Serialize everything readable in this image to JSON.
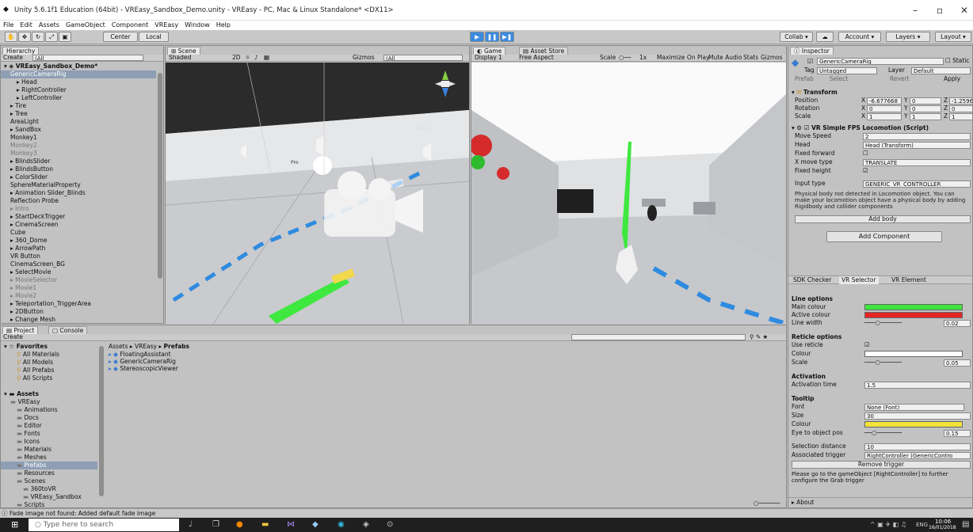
{
  "window": {
    "title": "Unity 5.6.1f1 Education (64bit) - VREasy_Sandbox_Demo.unity - VREasy - PC, Mac & Linux Standalone* <DX11>"
  },
  "menu": [
    "File",
    "Edit",
    "Assets",
    "GameObject",
    "Component",
    "VREasy",
    "Window",
    "Help"
  ],
  "toolbar": {
    "center": "Center",
    "local": "Local",
    "collab": "Collab",
    "account": "Account",
    "layers": "Layers",
    "layout": "Layout"
  },
  "hierarchy": {
    "tab": "Hierarchy",
    "create": "Create",
    "search": "(All",
    "scene": "VREasy_Sandbox_Demo*",
    "items": [
      {
        "label": "GenericCameraRig",
        "indent": 1,
        "state": "selected"
      },
      {
        "label": "Head",
        "indent": 2,
        "state": "collapsed"
      },
      {
        "label": "RightController",
        "indent": 2,
        "state": "collapsed"
      },
      {
        "label": "LeftController",
        "indent": 2,
        "state": "collapsed"
      },
      {
        "label": "Tire",
        "indent": 1,
        "state": "collapsed"
      },
      {
        "label": "Tree",
        "indent": 1,
        "state": "collapsed"
      },
      {
        "label": "AreaLight",
        "indent": 1,
        "state": ""
      },
      {
        "label": "SandBox",
        "indent": 1,
        "state": "collapsed"
      },
      {
        "label": "Monkey1",
        "indent": 1,
        "state": ""
      },
      {
        "label": "Monkey2",
        "indent": 1,
        "state": "inactive"
      },
      {
        "label": "Monkey3",
        "indent": 1,
        "state": "inactive"
      },
      {
        "label": "BlindsSlider",
        "indent": 1,
        "state": "collapsed"
      },
      {
        "label": "BlindsButton",
        "indent": 1,
        "state": "collapsed"
      },
      {
        "label": "ColorSlider",
        "indent": 1,
        "state": "collapsed"
      },
      {
        "label": "SphereMaterialProperty",
        "indent": 1,
        "state": ""
      },
      {
        "label": "Animation Slider_Blinds",
        "indent": 1,
        "state": "collapsed"
      },
      {
        "label": "Reflection Probe",
        "indent": 1,
        "state": ""
      },
      {
        "label": "Intro",
        "indent": 1,
        "state": "collapsed-inactive"
      },
      {
        "label": "StartDeckTrigger",
        "indent": 1,
        "state": "collapsed"
      },
      {
        "label": "CinemaScreen",
        "indent": 1,
        "state": "collapsed"
      },
      {
        "label": "Cube",
        "indent": 1,
        "state": ""
      },
      {
        "label": "360_Dome",
        "indent": 1,
        "state": "collapsed"
      },
      {
        "label": "ArrowPath",
        "indent": 1,
        "state": "collapsed"
      },
      {
        "label": "VR Button",
        "indent": 1,
        "state": ""
      },
      {
        "label": "CinemaScreen_BG",
        "indent": 1,
        "state": ""
      },
      {
        "label": "SelectMovie",
        "indent": 1,
        "state": "collapsed"
      },
      {
        "label": "MovieSelector",
        "indent": 1,
        "state": "collapsed-inactive"
      },
      {
        "label": "Movie1",
        "indent": 1,
        "state": "collapsed-inactive"
      },
      {
        "label": "Movie2",
        "indent": 1,
        "state": "collapsed-inactive"
      },
      {
        "label": "Teleportation_TriggerArea",
        "indent": 1,
        "state": "collapsed"
      },
      {
        "label": "2DButton",
        "indent": 1,
        "state": "collapsed"
      },
      {
        "label": "Change Mesh",
        "indent": 1,
        "state": "collapsed"
      }
    ]
  },
  "scene": {
    "tab": "Scene",
    "shaded": "Shaded",
    "mode2d": "2D",
    "gizmos": "Gizmos",
    "search": "(All",
    "persp": "Persp"
  },
  "game": {
    "tab": "Game",
    "asset_tab": "Asset Store",
    "display": "Display 1",
    "aspect": "Free Aspect",
    "scale": "Scale",
    "scale_val": "1x",
    "maximize": "Maximize On Play",
    "mute": "Mute Audio",
    "stats": "Stats",
    "gizmos": "Gizmos"
  },
  "inspector": {
    "tab": "Inspector",
    "object_name": "GenericCameraRig",
    "static": "Static",
    "tag_label": "Tag",
    "tag": "Untagged",
    "layer_label": "Layer",
    "layer": "Default",
    "prefab_label": "Prefab",
    "select": "Select",
    "revert": "Revert",
    "apply": "Apply",
    "transform": {
      "title": "Transform",
      "position": "Position",
      "rotation": "Rotation",
      "scale": "Scale",
      "px": "-6.677668",
      "py": "0",
      "pz": "-1.2596",
      "rx": "0",
      "ry": "0",
      "rz": "0",
      "sx": "1",
      "sy": "1",
      "sz": "1"
    },
    "locomotion": {
      "title": "VR Simple FPS Locomotion (Script)",
      "move_speed_label": "Move Speed",
      "move_speed": "2",
      "head_label": "Head",
      "head": "Head (Transform)",
      "fixed_forward": "Fixed forward",
      "x_move_label": "X move type",
      "x_move": "TRANSLATE",
      "fixed_height": "Fixed height",
      "input_label": "Input type",
      "input": "GENERIC_VR_CONTROLLER",
      "warning": "Physical body not detected in Locomotion object. You can make your locomotion object have a physical body by adding Rigidbody and collider components",
      "add_body": "Add body"
    },
    "add_component": "Add Component",
    "tabs": [
      "SDK Checker",
      "VR Selector",
      "VR Element"
    ],
    "line_options": "Line options",
    "main_colour": "Main colour",
    "active_colour": "Active colour",
    "line_width": "Line width",
    "line_width_val": "0.02",
    "reticle_options": "Reticle options",
    "use_reticle": "Use reticle",
    "colour": "Colour",
    "scale": "Scale",
    "scale_val": "0.05",
    "activation": "Activation",
    "activation_time": "Activation time",
    "activation_time_val": "1.5",
    "tooltip": "Tooltip",
    "font": "Font",
    "font_val": "None (Font)",
    "size": "Size",
    "size_val": "30",
    "tt_colour": "Colour",
    "eye_label": "Eye to object pos",
    "eye_val": "0.15",
    "sel_dist": "Selection distance",
    "sel_dist_val": "10",
    "assoc_trigger": "Associated trigger",
    "assoc_val": "RightController (GenericContro",
    "remove_trigger": "Remove trigger",
    "grab_note": "Please go to the gameObject [RightController] to further configure the Grab trigger",
    "about": "About",
    "colors": {
      "main": "#3ee53e",
      "active": "#e52525",
      "reticle": "#ffffff",
      "tooltip": "#f2e23a"
    }
  },
  "project": {
    "tab": "Project",
    "console_tab": "Console",
    "create": "Create",
    "breadcrumb": [
      "Assets",
      "VREasy",
      "Prefabs"
    ],
    "favorites": "Favorites",
    "fav_items": [
      "All Materials",
      "All Models",
      "All Prefabs",
      "All Scripts"
    ],
    "assets": "Assets",
    "tree": [
      {
        "label": "VREasy",
        "indent": 1
      },
      {
        "label": "Animations",
        "indent": 2
      },
      {
        "label": "Docs",
        "indent": 2
      },
      {
        "label": "Editor",
        "indent": 2
      },
      {
        "label": "Fonts",
        "indent": 2
      },
      {
        "label": "Icons",
        "indent": 2
      },
      {
        "label": "Materials",
        "indent": 2
      },
      {
        "label": "Meshes",
        "indent": 2
      },
      {
        "label": "Prefabs",
        "indent": 2
      },
      {
        "label": "Resources",
        "indent": 2
      },
      {
        "label": "Scenes",
        "indent": 2
      },
      {
        "label": "360toVR",
        "indent": 3
      },
      {
        "label": "VREasy_Sandbox",
        "indent": 3
      },
      {
        "label": "Scripts",
        "indent": 2
      }
    ],
    "files": [
      "FloatingAssistant",
      "GenericCameraRig",
      "StereoscopicViewer"
    ]
  },
  "status": "Fade image not found: Added default fade image",
  "taskbar": {
    "search": "Type here to search",
    "lang": "ENG",
    "time": "10:06",
    "date": "16/01/2018"
  }
}
